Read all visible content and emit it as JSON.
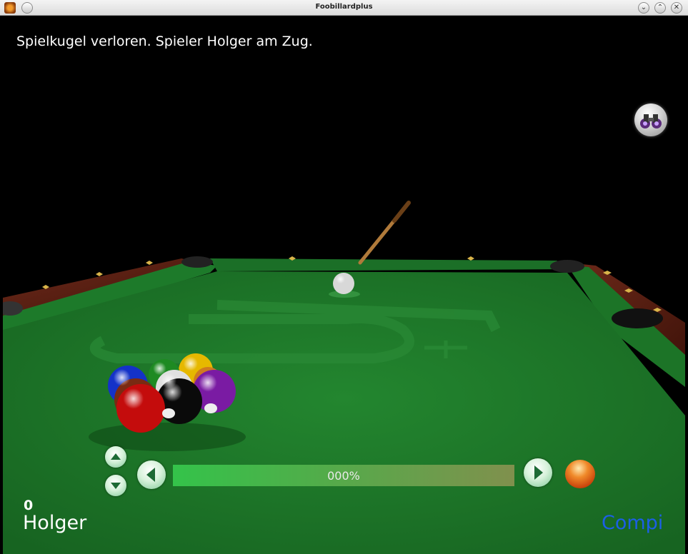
{
  "window": {
    "title": "Foobillardplus"
  },
  "game": {
    "status_message": "Spielkugel verloren. Spieler Holger am Zug.",
    "power_percent": "000%",
    "player1": {
      "name": "Holger",
      "score": "0"
    },
    "player2": {
      "name": "Compi"
    }
  },
  "icons": {
    "view": "binoculars-icon",
    "up": "arrow-up-icon",
    "down": "arrow-down-icon",
    "left": "arrow-left-icon",
    "right": "arrow-right-icon",
    "shoot": "orange-ball-icon"
  },
  "colors": {
    "felt": "#1e7a2a",
    "rail_wood": "#5a1f14",
    "active_player": "#ffffff",
    "inactive_player": "#1c5fe6"
  }
}
